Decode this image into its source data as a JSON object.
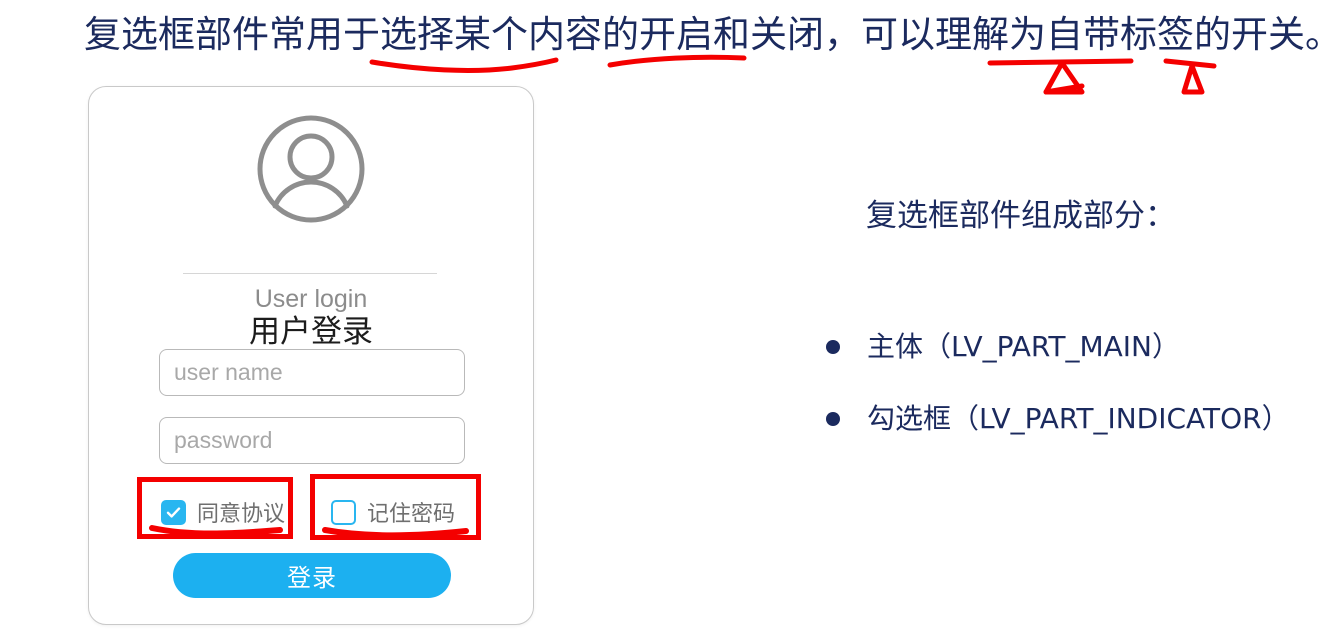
{
  "slide": {
    "title": "复选框部件常用于选择某个内容的开启和关闭，可以理解为自带标签的开关。",
    "title_color": "#1b2a5e",
    "annotation_color": "#f40000"
  },
  "login_card": {
    "avatar_icon": "user-avatar-icon",
    "heading": "用户登录",
    "subtitle": "User login",
    "username_placeholder": "user name",
    "username_value": "",
    "password_placeholder": "password",
    "password_value": "",
    "checkboxes": [
      {
        "label": "同意协议",
        "checked": true,
        "state_icon": "check-icon"
      },
      {
        "label": "记住密码",
        "checked": false,
        "state_icon": "empty-box-icon"
      }
    ],
    "submit_label": "登录",
    "accent_color": "#1cb0f0"
  },
  "right_panel": {
    "heading": "复选框部件组成部分：",
    "bullets": [
      {
        "text": "主体（LV_PART_MAIN）"
      },
      {
        "text": "勾选框（LV_PART_INDICATOR）"
      }
    ],
    "text_color": "#1b2a5e"
  }
}
